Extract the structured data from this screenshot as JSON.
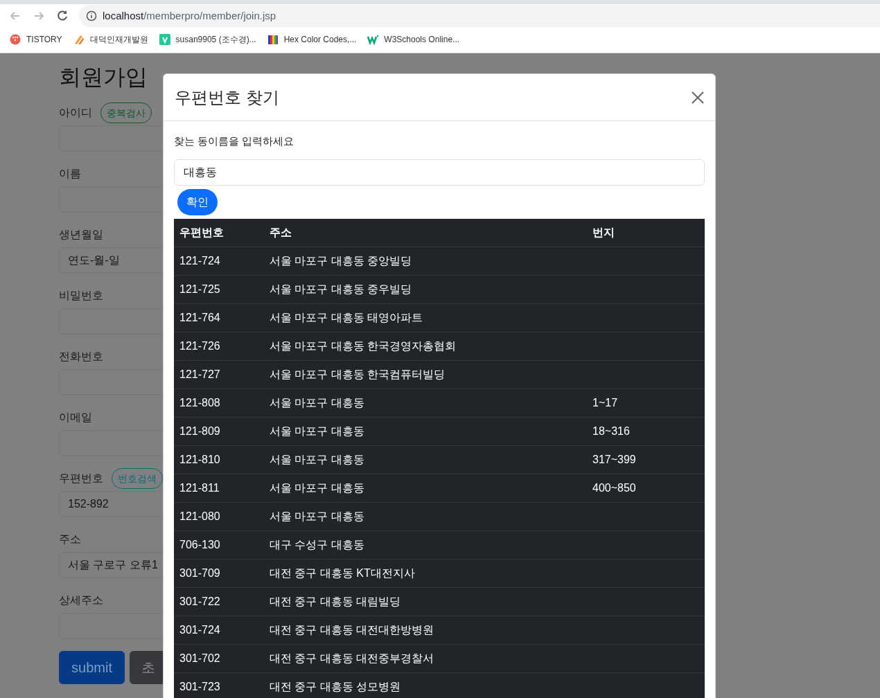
{
  "browser": {
    "url_host": "localhost",
    "url_path": "/memberpro/member/join.jsp",
    "bookmarks": [
      {
        "label": "TISTORY",
        "kind": "tistory"
      },
      {
        "label": "대덕인재개발원",
        "kind": "ddit"
      },
      {
        "label": "susan9905 (조수경)...",
        "kind": "velog"
      },
      {
        "label": "Hex Color Codes,...",
        "kind": "hex"
      },
      {
        "label": "W3Schools Online...",
        "kind": "w3"
      }
    ]
  },
  "page": {
    "title": "회원가입",
    "fields": [
      {
        "label": "아이디",
        "button": "중복검사",
        "color": "#0d5a2d"
      },
      {
        "label": "이름"
      },
      {
        "label": "생년월일",
        "value": "연도-월-일"
      },
      {
        "label": "비밀번호"
      },
      {
        "label": "전화번호"
      },
      {
        "label": "이메일"
      },
      {
        "label": "우편번호",
        "button": "번호검색",
        "color": "#0b6a7a",
        "value": "152-892"
      },
      {
        "label": "주소",
        "value": "서울 구로구 오류1"
      },
      {
        "label": "상세주소"
      }
    ],
    "buttons": [
      {
        "label": "submit",
        "kind": "primary"
      },
      {
        "label": "초",
        "kind": "secondary"
      }
    ]
  },
  "modal": {
    "title": "우편번호 찾기",
    "prompt": "찾는 동이름을 입력하세요",
    "search_value": "대흥동",
    "confirm": "확인",
    "table": {
      "columns": [
        "우편번호",
        "주소",
        "번지"
      ],
      "rows": [
        [
          "121-724",
          "서울 마포구 대흥동 중앙빌딩",
          ""
        ],
        [
          "121-725",
          "서울 마포구 대흥동 중우빌딩",
          ""
        ],
        [
          "121-764",
          "서울 마포구 대흥동 태영아파트",
          ""
        ],
        [
          "121-726",
          "서울 마포구 대흥동 한국경영자총협회",
          ""
        ],
        [
          "121-727",
          "서울 마포구 대흥동 한국컴퓨터빌딩",
          ""
        ],
        [
          "121-808",
          "서울 마포구 대흥동",
          "1~17"
        ],
        [
          "121-809",
          "서울 마포구 대흥동",
          "18~316"
        ],
        [
          "121-810",
          "서울 마포구 대흥동",
          "317~399"
        ],
        [
          "121-811",
          "서울 마포구 대흥동",
          "400~850"
        ],
        [
          "121-080",
          "서울 마포구 대흥동",
          ""
        ],
        [
          "706-130",
          "대구 수성구 대흥동",
          ""
        ],
        [
          "301-709",
          "대전 중구 대흥동 KT대전지사",
          ""
        ],
        [
          "301-722",
          "대전 중구 대흥동 대림빌딩",
          ""
        ],
        [
          "301-724",
          "대전 중구 대흥동 대전대한방병원",
          ""
        ],
        [
          "301-702",
          "대전 중구 대흥동 대전중부경찰서",
          ""
        ],
        [
          "301-723",
          "대전 중구 대흥동 성모병원",
          ""
        ]
      ]
    }
  }
}
